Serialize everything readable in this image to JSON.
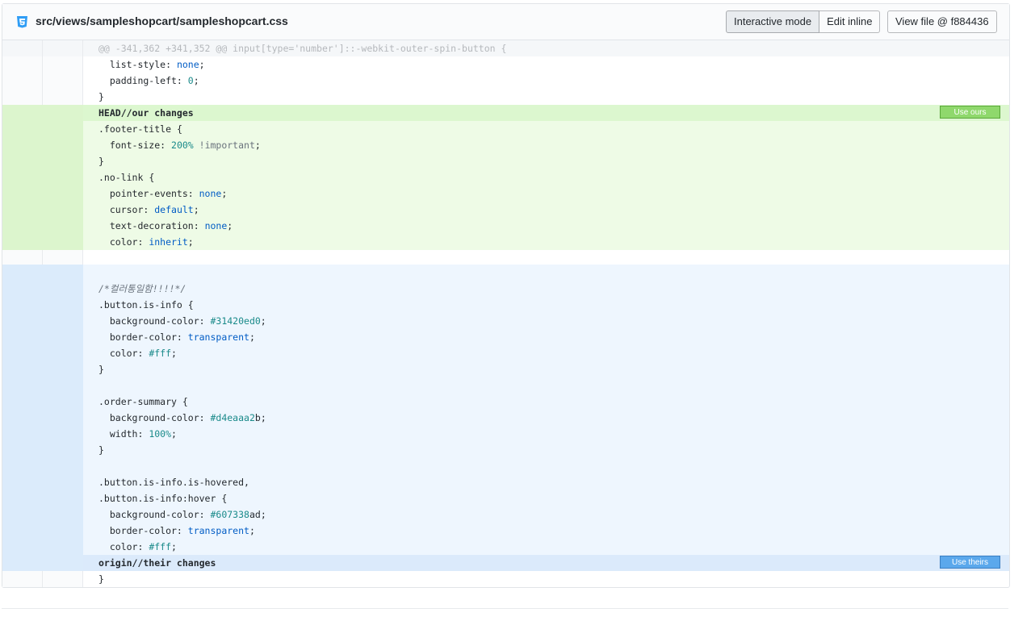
{
  "file": {
    "path": "src/views/sampleshopcart/sampleshopcart.css",
    "icon": "css3-icon",
    "buttons": {
      "interactive_mode": "Interactive mode",
      "edit_inline": "Edit inline",
      "view_file": "View file @ f884436"
    }
  },
  "diff": {
    "hunk_header": "@@ -341,362 +341,352 @@ input[type='number']::-webkit-outer-spin-button {",
    "context_before": {
      "l1_prop": "  list-style: ",
      "l1_val": "none",
      "l1_end": ";",
      "l2_prop": "  padding-left: ",
      "l2_val": "0",
      "l2_end": ";",
      "l3": "}"
    },
    "ours": {
      "header": "HEAD//our changes",
      "use_label": "Use ours",
      "l1_sel": ".footer-title",
      "l1_rest": " {",
      "l2_prop": "  font-size: ",
      "l2_val": "200%",
      "l2_imp": " !important",
      "l2_end": ";",
      "l3": "}",
      "l4_sel": ".no-link",
      "l4_rest": " {",
      "l5_prop": "  pointer-events: ",
      "l5_val": "none",
      "l5_end": ";",
      "l6_prop": "  cursor: ",
      "l6_val": "default",
      "l6_end": ";",
      "l7_prop": "  text-decoration: ",
      "l7_val": "none",
      "l7_end": ";",
      "l8_prop": "  color: ",
      "l8_val": "inherit",
      "l8_end": ";"
    },
    "theirs": {
      "comment": "/*컬러통일함!!!!*/",
      "a1_sel": ".button.is-info",
      "a1_rest": " {",
      "a2_prop": "  background-color: ",
      "a2_val": "#31420ed0",
      "a2_end": ";",
      "a3_prop": "  border-color: ",
      "a3_val": "transparent",
      "a3_end": ";",
      "a4_prop": "  color: ",
      "a4_val": "#fff",
      "a4_end": ";",
      "a5": "}",
      "b1_sel": ".order-summary",
      "b1_rest": " {",
      "b2_prop": "  background-color: ",
      "b2_val": "#d4eaaa2",
      "b2_tail": "b",
      "b2_end": ";",
      "b3_prop": "  width: ",
      "b3_val": "100%",
      "b3_end": ";",
      "b4": "}",
      "c1_sel": ".button.is-info.is-hovered,",
      "c2_sel": ".button.is-info",
      "c2_rest": ":hover {",
      "c3_prop": "  background-color: ",
      "c3_val": "#607338",
      "c3_tail": "ad",
      "c3_end": ";",
      "c4_prop": "  border-color: ",
      "c4_val": "transparent",
      "c4_end": ";",
      "c5_prop": "  color: ",
      "c5_val": "#fff",
      "c5_end": ";",
      "footer": "origin//their changes",
      "use_label": "Use theirs"
    },
    "context_after": "}"
  },
  "colors": {
    "ours_bg": "#eefbe6",
    "theirs_bg": "#eef6fe",
    "use_ours_btn": "#8fd86c",
    "use_theirs_btn": "#5ba8ec"
  }
}
